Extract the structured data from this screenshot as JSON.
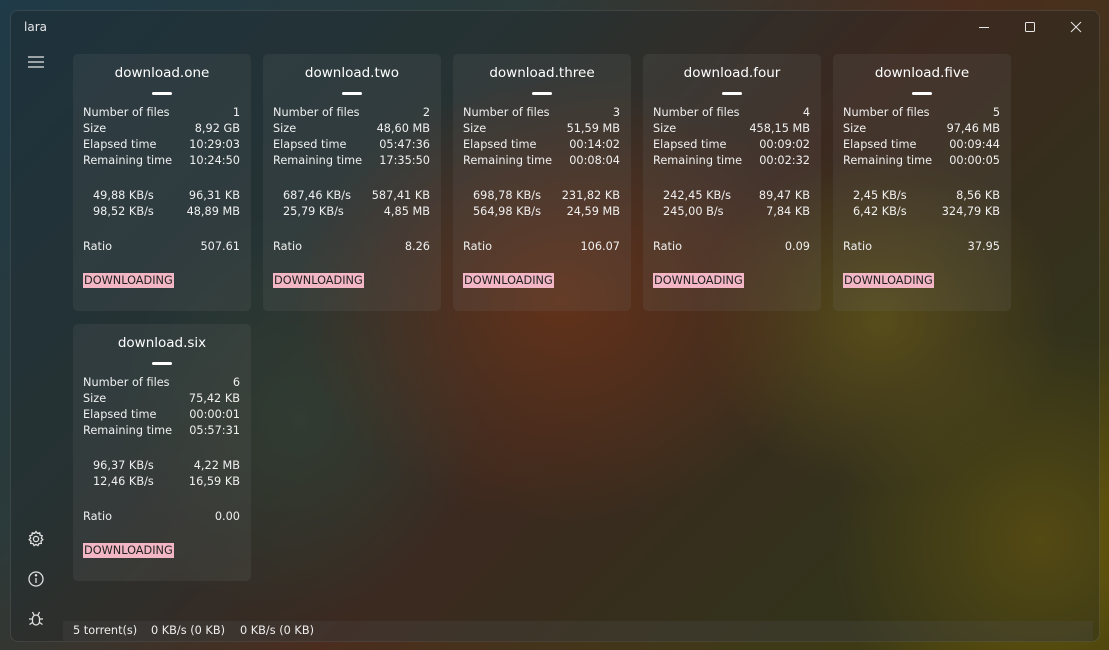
{
  "window": {
    "title": "lara"
  },
  "colors": {
    "status_badge_bg": "#f3b6c4",
    "status_badge_text": "#222222"
  },
  "labels": {
    "number_of_files": "Number of files",
    "size": "Size",
    "elapsed_time": "Elapsed time",
    "remaining_time": "Remaining time",
    "ratio": "Ratio"
  },
  "icons": {
    "menu": "hamburger-menu-icon",
    "settings": "gear-icon",
    "about": "info-icon",
    "debug": "bug-icon",
    "minimize": "minimize-icon",
    "maximize": "maximize-icon",
    "close": "close-icon"
  },
  "torrents": [
    {
      "name": "download.one",
      "files": "1",
      "size": "8,92 GB",
      "elapsed": "10:29:03",
      "remaining": "10:24:50",
      "down_speed": "49,88 KB/s",
      "downloaded": "96,31 KB",
      "up_speed": "98,52 KB/s",
      "uploaded": "48,89 MB",
      "ratio": "507.61",
      "status": "DOWNLOADING"
    },
    {
      "name": "download.two",
      "files": "2",
      "size": "48,60 MB",
      "elapsed": "05:47:36",
      "remaining": "17:35:50",
      "down_speed": "687,46 KB/s",
      "downloaded": "587,41 KB",
      "up_speed": "25,79 KB/s",
      "uploaded": "4,85 MB",
      "ratio": "8.26",
      "status": "DOWNLOADING"
    },
    {
      "name": "download.three",
      "files": "3",
      "size": "51,59 MB",
      "elapsed": "00:14:02",
      "remaining": "00:08:04",
      "down_speed": "698,78 KB/s",
      "downloaded": "231,82 KB",
      "up_speed": "564,98 KB/s",
      "uploaded": "24,59 MB",
      "ratio": "106.07",
      "status": "DOWNLOADING"
    },
    {
      "name": "download.four",
      "files": "4",
      "size": "458,15 MB",
      "elapsed": "00:09:02",
      "remaining": "00:02:32",
      "down_speed": "242,45 KB/s",
      "downloaded": "89,47 KB",
      "up_speed": "245,00 B/s",
      "uploaded": "7,84 KB",
      "ratio": "0.09",
      "status": "DOWNLOADING"
    },
    {
      "name": "download.five",
      "files": "5",
      "size": "97,46 MB",
      "elapsed": "00:09:44",
      "remaining": "00:00:05",
      "down_speed": "2,45 KB/s",
      "downloaded": "8,56 KB",
      "up_speed": "6,42 KB/s",
      "uploaded": "324,79 KB",
      "ratio": "37.95",
      "status": "DOWNLOADING"
    },
    {
      "name": "download.six",
      "files": "6",
      "size": "75,42 KB",
      "elapsed": "00:00:01",
      "remaining": "05:57:31",
      "down_speed": "96,37 KB/s",
      "downloaded": "4,22 MB",
      "up_speed": "12,46 KB/s",
      "uploaded": "16,59 KB",
      "ratio": "0.00",
      "status": "DOWNLOADING"
    }
  ],
  "statusbar": {
    "torrent_count": "5 torrent(s)",
    "download_total": "0 KB/s (0 KB)",
    "upload_total": "0 KB/s (0 KB)"
  }
}
